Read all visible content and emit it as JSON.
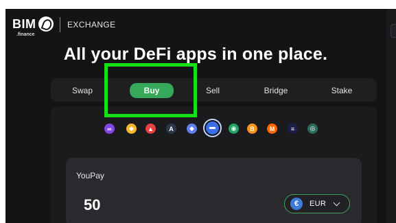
{
  "header": {
    "brand": "BIM",
    "brand_sub": ".finance",
    "section": "EXCHANGE"
  },
  "headline": "All your DeFi apps in one place.",
  "tabs": [
    {
      "label": "Swap",
      "active": false
    },
    {
      "label": "Buy",
      "active": true
    },
    {
      "label": "Sell",
      "active": false
    },
    {
      "label": "Bridge",
      "active": false
    },
    {
      "label": "Stake",
      "active": false
    }
  ],
  "networks": [
    {
      "icon": "polygon-icon",
      "color": "#8247e5",
      "glyph": "∞"
    },
    {
      "icon": "bnb-icon",
      "color": "#f3ba2f",
      "glyph": "◆"
    },
    {
      "icon": "avalanche-icon",
      "color": "#e84142",
      "glyph": "▲"
    },
    {
      "icon": "arbitrum-icon",
      "color": "#2d374b",
      "glyph": "A"
    },
    {
      "icon": "ethereum-icon",
      "color": "#627eea",
      "glyph": "◆"
    },
    {
      "icon": "selected-network-icon",
      "color": "#3a6fe8",
      "glyph": "",
      "selected": true
    },
    {
      "icon": "green-chain-icon",
      "color": "#1fa463",
      "glyph": "◉"
    },
    {
      "icon": "bitcoin-icon",
      "color": "#f7931a",
      "glyph": "B"
    },
    {
      "icon": "monero-icon",
      "color": "#ff6600",
      "glyph": "M"
    },
    {
      "icon": "solana-icon",
      "color": "#1b1f4a",
      "glyph": "≡"
    },
    {
      "icon": "teal-chain-icon",
      "color": "#2a6b5a",
      "glyph": "◎"
    }
  ],
  "pay": {
    "label": "YouPay",
    "amount": "50",
    "currency": "EUR",
    "currency_icon": "euro-icon",
    "currency_color": "#3d7bd9"
  },
  "colors": {
    "accent_green": "#35a85a",
    "highlight": "#16e116",
    "background": "#141416"
  }
}
